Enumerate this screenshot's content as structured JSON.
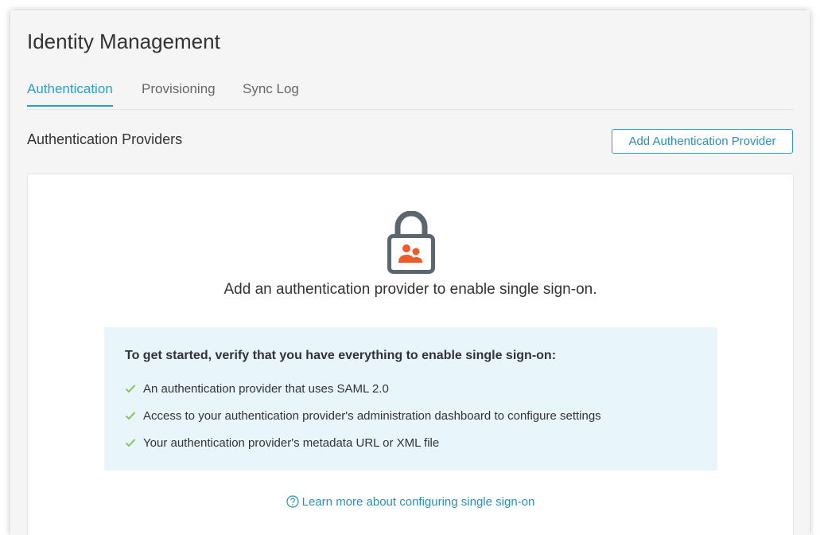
{
  "page": {
    "title": "Identity Management"
  },
  "tabs": [
    {
      "label": "Authentication",
      "active": true
    },
    {
      "label": "Provisioning",
      "active": false
    },
    {
      "label": "Sync Log",
      "active": false
    }
  ],
  "section": {
    "title": "Authentication Providers",
    "add_button_label": "Add Authentication Provider"
  },
  "empty_state": {
    "icon": "lock-users-icon",
    "message": "Add an authentication provider to enable single sign-on.",
    "checklist_heading": "To get started, verify that you have everything to enable single sign-on:",
    "checklist": [
      "An authentication provider that uses SAML 2.0",
      "Access to your authentication provider's administration dashboard to configure settings",
      "Your authentication provider's metadata URL or XML file"
    ],
    "learn_more_label": "Learn more about configuring single sign-on"
  },
  "colors": {
    "accent": "#2aa0c9",
    "check": "#7cc04b",
    "lock_body": "#5b6670",
    "lock_users": "#f05a28",
    "info_background": "#e8f5fa"
  }
}
